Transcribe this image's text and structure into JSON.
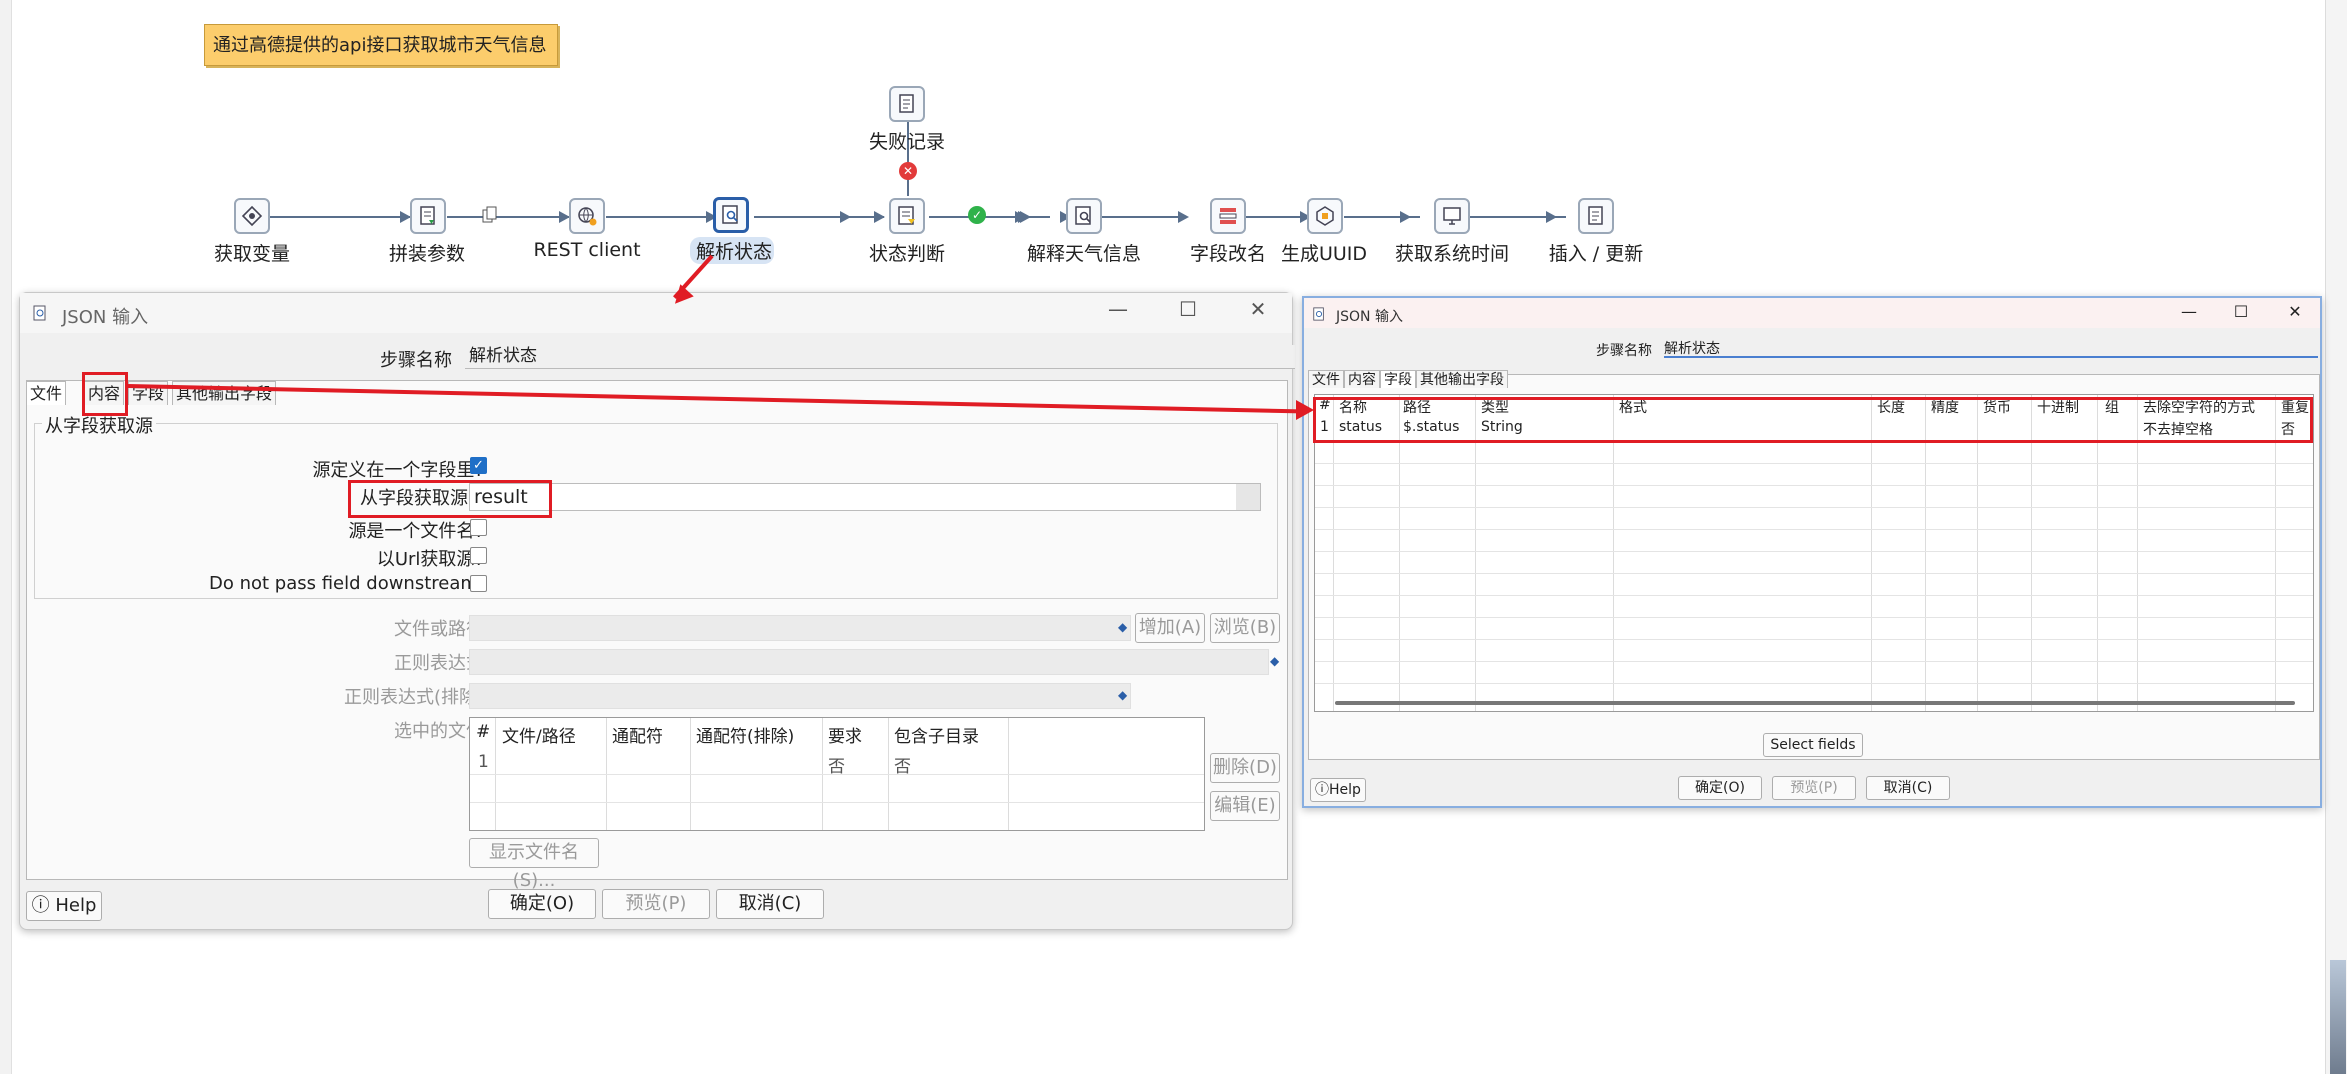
{
  "canvas": {
    "note": "通过高德提供的api接口获取城市天气信息",
    "steps": [
      {
        "label": "获取变量"
      },
      {
        "label": "拼装参数"
      },
      {
        "label": "REST client"
      },
      {
        "label": "解析状态"
      },
      {
        "label": "状态判断"
      },
      {
        "label": "解释天气信息"
      },
      {
        "label": "字段改名"
      },
      {
        "label": "生成UUID"
      },
      {
        "label": "获取系统时间"
      },
      {
        "label": "插入 / 更新"
      },
      {
        "label": "失败记录"
      }
    ]
  },
  "dialog_left": {
    "title": "JSON 输入",
    "step_name_label": "步骤名称",
    "step_name_value": "解析状态",
    "tabs": [
      "文件",
      "内容",
      "字段",
      "其他输出字段"
    ],
    "group_title": "从字段获取源",
    "source_in_field_label": "源定义在一个字段里?",
    "source_field_label": "从字段获取源",
    "source_field_value": "result",
    "is_filename_label": "源是一个文件名?",
    "from_url_label": "以Url获取源?",
    "no_pass_label": "Do not pass field downstream:",
    "file_path_label": "文件或路径",
    "regex_label": "正则表达式",
    "regex_exclude_label": "正则表达式(排除)",
    "selected_files_label": "选中的文件",
    "add_btn": "增加(A)",
    "browse_btn": "浏览(B)",
    "delete_btn": "删除(D)",
    "edit_btn": "编辑(E)",
    "show_files_btn": "显示文件名(S)...",
    "table": {
      "headers": [
        "#",
        "文件/路径",
        "通配符",
        "通配符(排除)",
        "要求",
        "包含子目录"
      ],
      "rows": [
        [
          "1",
          "",
          "",
          "",
          "否",
          "否"
        ]
      ]
    },
    "help_btn": "Help",
    "ok_btn": "确定(O)",
    "preview_btn": "预览(P)",
    "cancel_btn": "取消(C)"
  },
  "dialog_right": {
    "title": "JSON 输入",
    "step_name_label": "步骤名称",
    "step_name_value": "解析状态",
    "tabs": [
      "文件",
      "内容",
      "字段",
      "其他输出字段"
    ],
    "table": {
      "headers": [
        "#",
        "名称",
        "路径",
        "类型",
        "格式",
        "长度",
        "精度",
        "货币",
        "十进制",
        "组",
        "去除空字符的方式",
        "重复"
      ],
      "rows": [
        [
          "1",
          "status",
          "$.status",
          "String",
          "",
          "",
          "",
          "",
          "",
          "",
          "不去掉空格",
          "否"
        ]
      ]
    },
    "select_fields_btn": "Select fields",
    "help_btn": "Help",
    "ok_btn": "确定(O)",
    "preview_btn": "预览(P)",
    "cancel_btn": "取消(C)"
  },
  "colors": {
    "annotation_red": "#e01c24",
    "note_bg": "#fccd6c",
    "accent_blue": "#1f6fc7"
  }
}
